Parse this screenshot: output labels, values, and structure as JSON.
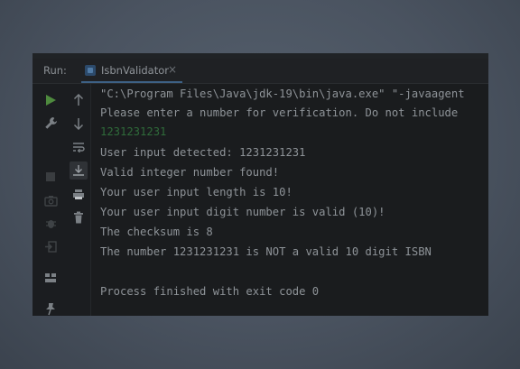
{
  "run_panel": {
    "label": "Run:",
    "tab": {
      "title": "IsbnValidator",
      "close": "×",
      "icon": "java-class-icon"
    }
  },
  "toolbar_left": [
    {
      "name": "run-icon",
      "color": "#4e8a3e"
    },
    {
      "name": "wrench-icon"
    },
    {
      "name": "stop-icon"
    },
    {
      "name": "camera-icon"
    },
    {
      "name": "bug-icon"
    },
    {
      "name": "exit-icon"
    },
    {
      "name": "layout-icon"
    },
    {
      "name": "pin-icon"
    }
  ],
  "toolbar_right": [
    {
      "name": "scroll-up-icon"
    },
    {
      "name": "scroll-down-icon"
    },
    {
      "name": "soft-wrap-icon"
    },
    {
      "name": "scroll-to-end-icon"
    },
    {
      "name": "print-icon"
    },
    {
      "name": "trash-icon"
    }
  ],
  "console": {
    "lines": [
      "\"C:\\Program Files\\Java\\jdk-19\\bin\\java.exe\" \"-javaagent",
      "Please enter a number for verification. Do not include",
      "1231231231",
      "User input detected: 1231231231",
      "Valid integer number found!",
      "Your user input length is 10!",
      "Your user input digit number is valid (10)!",
      "The checksum is 8",
      "The number 1231231231 is NOT a valid 10 digit ISBN",
      "",
      "Process finished with exit code 0"
    ],
    "input_color": "#2f6b3a"
  }
}
